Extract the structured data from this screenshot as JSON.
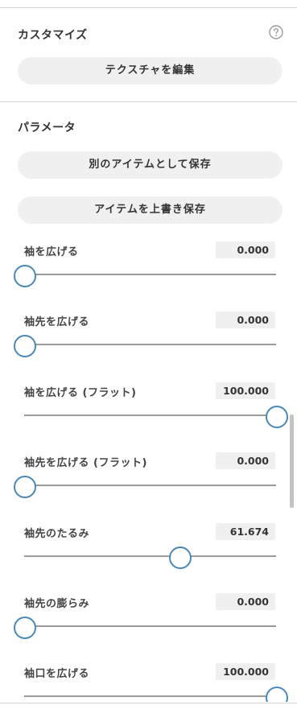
{
  "customize": {
    "title": "カスタマイズ",
    "help_icon": "question-circle-icon",
    "edit_texture_label": "テクスチャを編集"
  },
  "parameters": {
    "title": "パラメータ",
    "save_as_new_label": "別のアイテムとして保存",
    "overwrite_label": "アイテムを上書き保存",
    "items": [
      {
        "label": "袖を広げる",
        "value": "0.000",
        "fraction": 0.0
      },
      {
        "label": "袖先を広げる",
        "value": "0.000",
        "fraction": 0.0
      },
      {
        "label": "袖を広げる (フラット)",
        "value": "100.000",
        "fraction": 1.0
      },
      {
        "label": "袖先を広げる (フラット)",
        "value": "0.000",
        "fraction": 0.0
      },
      {
        "label": "袖先のたるみ",
        "value": "61.674",
        "fraction": 0.6167
      },
      {
        "label": "袖先の膨らみ",
        "value": "0.000",
        "fraction": 0.0
      },
      {
        "label": "袖口を広げる",
        "value": "100.000",
        "fraction": 1.0
      }
    ]
  },
  "colors": {
    "thumb_border": "#4a88b8",
    "track": "#9a9a9a",
    "button_bg": "#f0f0f0"
  }
}
